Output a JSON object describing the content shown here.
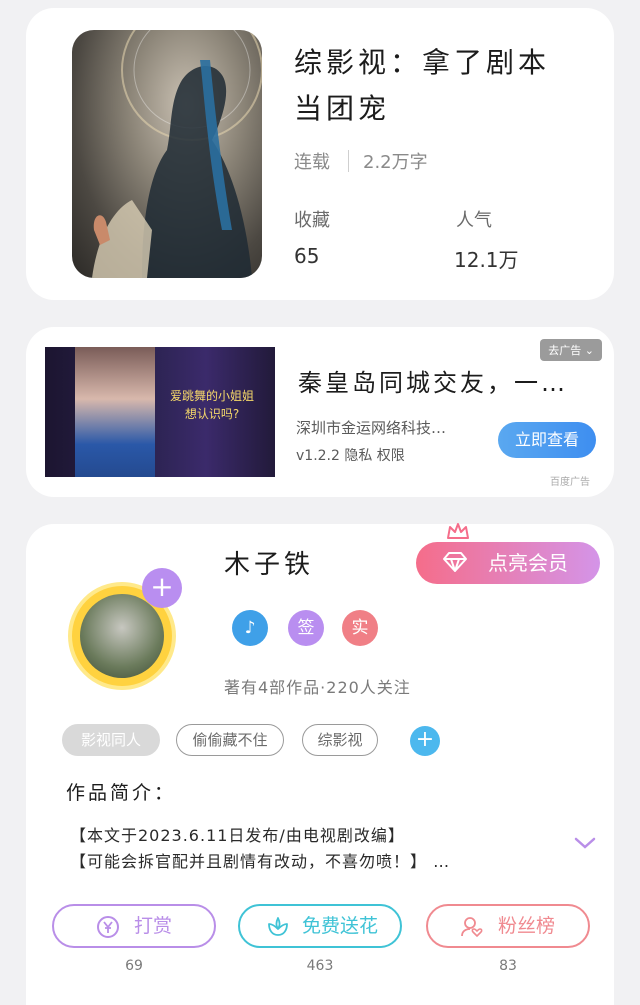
{
  "book": {
    "title_line1": "综影视：拿了剧本",
    "title_line2": "当团宠",
    "status": "连载",
    "word_count": "2.2万字",
    "favorites_label": "收藏",
    "favorites_value": "65",
    "popularity_label": "人气",
    "popularity_value": "12.1万"
  },
  "ad": {
    "close_label": "去广告",
    "image_caption": "爱跳舞的小姐姐想认识吗?",
    "title": "秦皇岛同城交友，一…",
    "company": "深圳市金运网络科技…",
    "version_line": "v1.2.2 隐私 权限",
    "cta": "立即查看",
    "source": "百度广告"
  },
  "author": {
    "name": "木子铁",
    "vip_label": "点亮会员",
    "badges": [
      "♪",
      "签",
      "实"
    ],
    "stats": "著有4部作品·220人关注",
    "tags": [
      "影视同人",
      "偷偷藏不住",
      "综影视"
    ],
    "intro_label": "作品简介：",
    "intro_line1": "【本文于2023.6.11日发布/由电视剧改编】",
    "intro_line2": "【可能会拆官配并且剧情有改动，不喜勿喷！】 …"
  },
  "actions": {
    "reward_label": "打赏",
    "reward_count": "69",
    "flower_label": "免费送花",
    "flower_count": "463",
    "fans_label": "粉丝榜",
    "fans_count": "83"
  },
  "colors": {
    "reward": "#b98ee8",
    "flower": "#3fc3d6",
    "fans": "#f08a90",
    "vip_start": "#f56d8a",
    "vip_end": "#d494e8",
    "ad_button": "#3e8ef0"
  }
}
